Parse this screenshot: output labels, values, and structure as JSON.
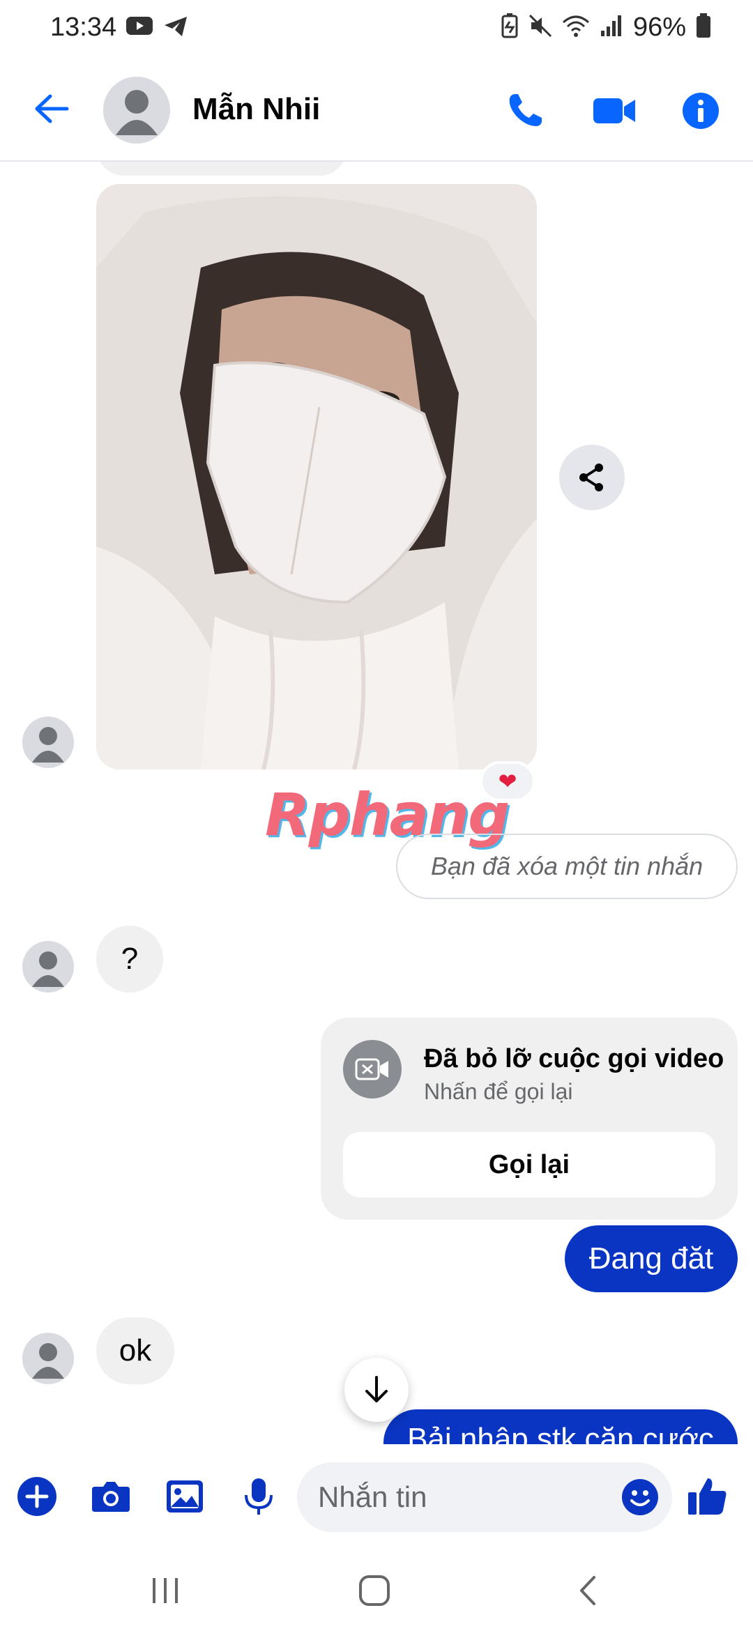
{
  "status_bar": {
    "time": "13:34",
    "battery": "96%",
    "left_icons": [
      "youtube-icon",
      "telegram-icon"
    ],
    "right_icons": [
      "battery-saver-icon",
      "mute-icon",
      "wifi-icon",
      "signal-icon",
      "battery-icon"
    ]
  },
  "header": {
    "contact_name": "Mẫn Nhii",
    "icons": [
      "back-arrow-icon",
      "phone-icon",
      "video-camera-icon",
      "info-icon"
    ]
  },
  "messages": {
    "reaction": "❤",
    "watermark": "Rphang",
    "deleted_note": "Bạn đã xóa một tin nhắn",
    "question": "?",
    "missed_call": {
      "title": "Đã bỏ lỡ cuộc gọi video",
      "subtitle": "Nhấn để gọi lại",
      "button": "Gọi lại"
    },
    "out_1": "Đang đăt",
    "in_ok": "ok",
    "out_2_partial": "Bải nhập stk căn cước"
  },
  "composer": {
    "placeholder": "Nhắn tin",
    "icons": [
      "plus-icon",
      "camera-icon",
      "gallery-icon",
      "microphone-icon",
      "emoji-icon",
      "thumbs-up-icon"
    ]
  },
  "colors": {
    "accent": "#0a35c2",
    "icon_blue": "#0866ff",
    "bubble_grey": "#f0f0f0",
    "text": "#050505",
    "muted": "#65676b"
  }
}
